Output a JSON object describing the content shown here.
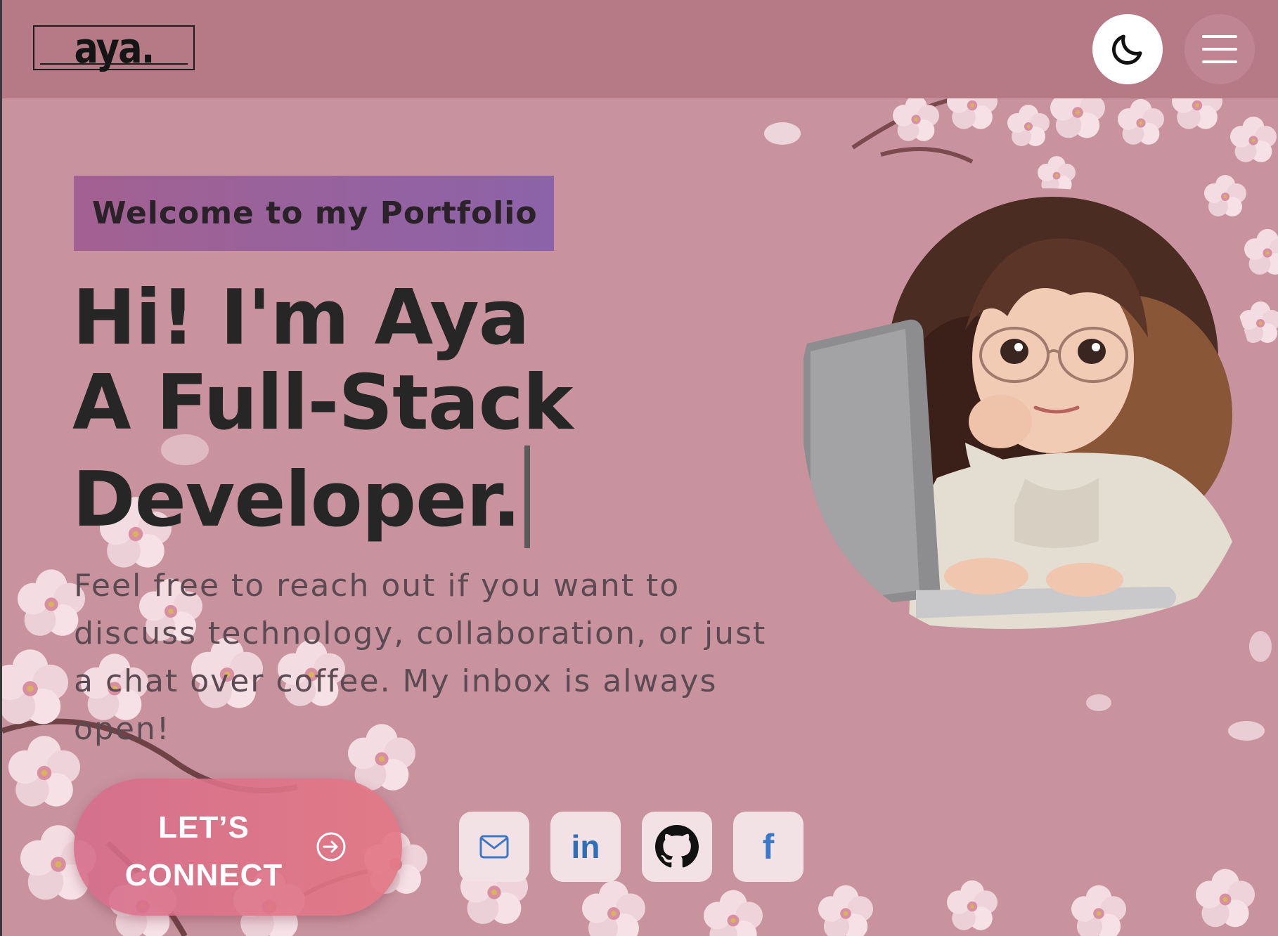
{
  "header": {
    "logo_text": "aya.",
    "theme_toggle_icon": "moon-icon",
    "menu_icon": "hamburger-menu-icon"
  },
  "hero": {
    "welcome_tag": "Welcome to my Portfolio",
    "headline_lines": [
      "Hi! I'm Aya",
      "A Full-Stack",
      "Developer."
    ],
    "intro": "Feel free to reach out if you want to discuss technology, collaboration, or just a chat over coffee. My inbox is always open!",
    "cta": {
      "line1": "LET’S",
      "line2": "CONNECT",
      "icon": "arrow-right-circle-icon"
    },
    "socials": [
      {
        "name": "email",
        "icon": "mail-icon"
      },
      {
        "name": "linkedin",
        "icon": "linkedin-icon",
        "text": "in"
      },
      {
        "name": "github",
        "icon": "github-icon"
      },
      {
        "name": "facebook",
        "icon": "facebook-icon",
        "text": "f"
      }
    ],
    "illustration": "avatar-girl-with-laptop"
  },
  "colors": {
    "background": "#c8939f",
    "header": "#b67a87",
    "text_dark": "#262626",
    "tag_gradient_start": "#a36191",
    "tag_gradient_end": "#8c63a9",
    "cta_gradient": "#d66c8a",
    "social_tile": "#f2e2e5",
    "social_blue": "#3b78c8"
  }
}
